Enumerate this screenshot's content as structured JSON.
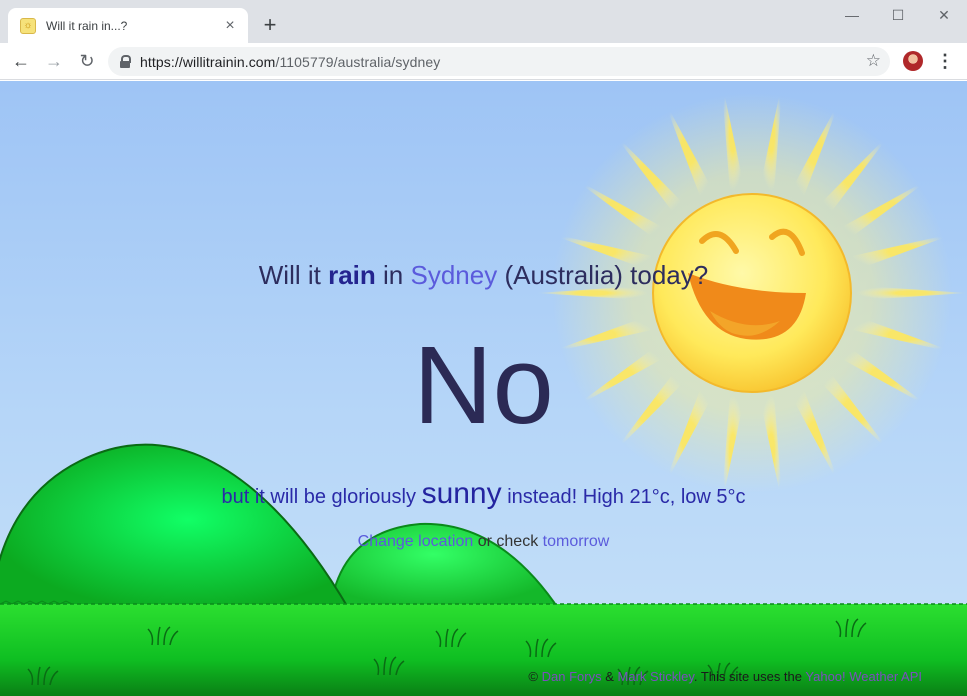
{
  "browser": {
    "tab_title": "Will it rain in...?",
    "new_tab_label": "+",
    "url_host": "https://willitrainin.com",
    "url_path": "/1105779/australia/sydney"
  },
  "page": {
    "question_prefix": "Will it",
    "question_rain": "rain",
    "question_in": "in",
    "city": "Sydney",
    "question_suffix": "(Australia) today?",
    "answer": "No",
    "detail_prefix": "but it will be gloriously",
    "detail_weather": "sunny",
    "detail_suffix": "instead! High 21°c, low 5°c",
    "change_location_link": "Change location",
    "or_check_text": "or check",
    "tomorrow_link": "tomorrow",
    "footer_copyright": "©",
    "footer_author1": "Dan Forys",
    "footer_amp": "&",
    "footer_author2": "Mark Stickley",
    "footer_uses": ". This site uses the",
    "footer_api_link": "Yahoo! Weather API"
  },
  "icons": {
    "back": "arrow-left-icon",
    "forward": "arrow-right-icon",
    "reload": "reload-icon",
    "lock": "lock-icon",
    "star": "star-icon",
    "menu": "kebab-menu-icon"
  },
  "colors": {
    "sky_top": "#9ec4f5",
    "grass": "#22cc33",
    "sun": "#ffe04a",
    "link": "#5b5bdc"
  }
}
